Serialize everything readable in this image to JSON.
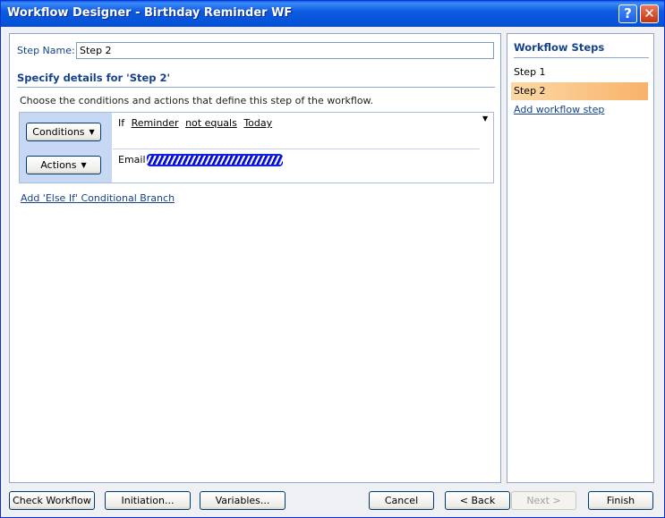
{
  "window": {
    "title": "Workflow Designer - Birthday Reminder WF",
    "help_label": "?",
    "close_label": "✕"
  },
  "main": {
    "step_name_label": "Step Name:",
    "step_name_value": "Step 2",
    "section_title": "Specify details for 'Step 2'",
    "instructions": "Choose the conditions and actions that define this step of the workflow.",
    "conditions_button": "Conditions",
    "actions_button": "Actions",
    "condition": {
      "prefix": "If",
      "field": "Reminder",
      "operator": "not equals",
      "value": "Today"
    },
    "action": {
      "prefix": "Email"
    },
    "else_if_link": "Add 'Else If' Conditional Branch"
  },
  "sidebar": {
    "title": "Workflow Steps",
    "steps": [
      {
        "label": "Step 1",
        "selected": false
      },
      {
        "label": "Step 2",
        "selected": true
      }
    ],
    "add_step_link": "Add workflow step"
  },
  "footer": {
    "check_workflow": "Check Workflow",
    "initiation": "Initiation...",
    "variables": "Variables...",
    "cancel": "Cancel",
    "back": "< Back",
    "next": "Next >",
    "finish": "Finish"
  },
  "colors": {
    "title_bar": "#0553D8",
    "heading_text": "#15428B",
    "selected_step": "#F8B26A",
    "rule_panel": "#C6D8F3"
  }
}
